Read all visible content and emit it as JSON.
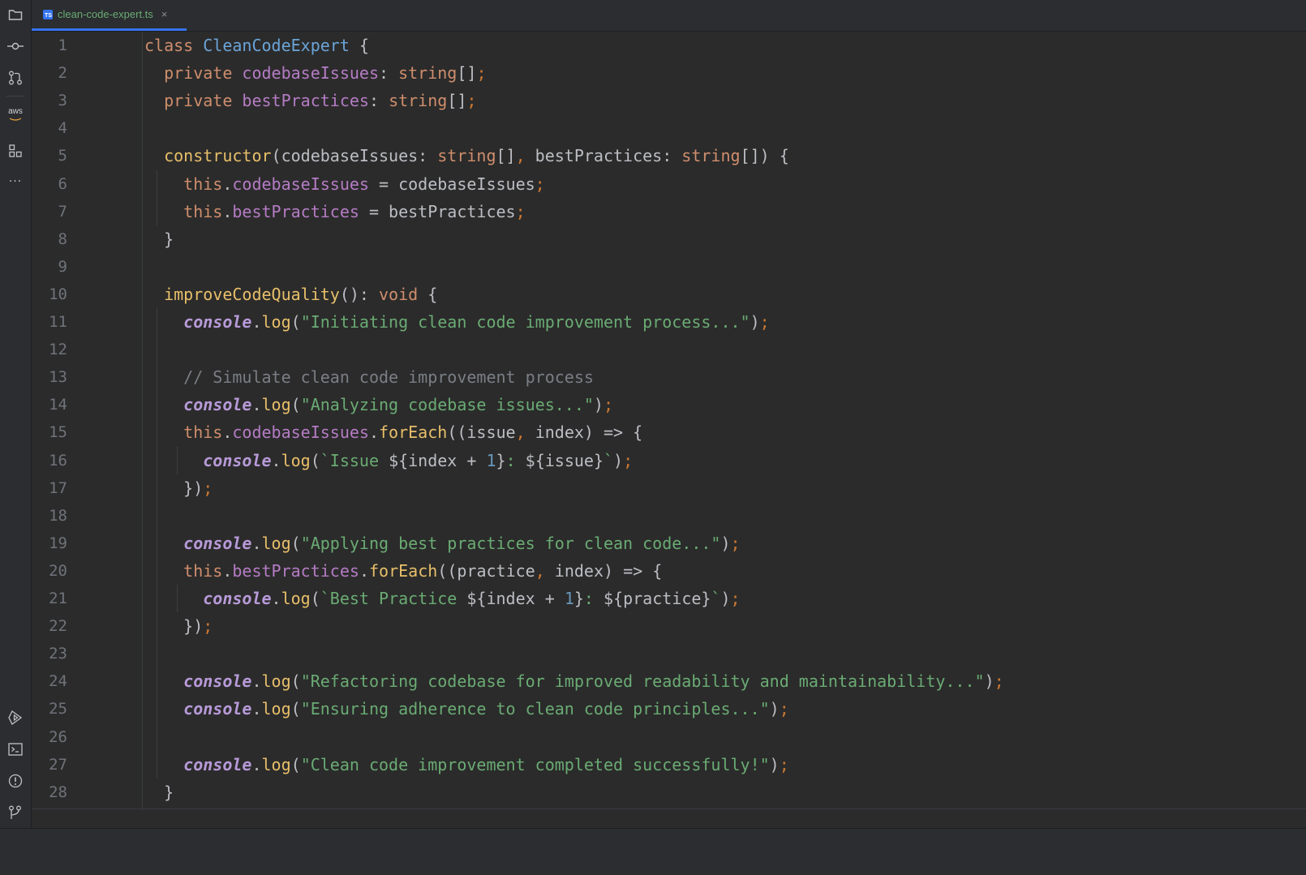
{
  "tab": {
    "filename": "clean-code-expert.ts",
    "badge": "TS",
    "close": "×"
  },
  "sidebar": {
    "aws_label": "aws",
    "more": "···"
  },
  "colors": {
    "keyword": "#cf8e6d",
    "class": "#6ba4d8",
    "property": "#b57cc5",
    "function": "#e8bf6a",
    "string": "#6aab73",
    "number": "#6897bb",
    "comment": "#7a7e85",
    "accent": "#3574f0"
  },
  "line_numbers": [
    "1",
    "2",
    "3",
    "4",
    "5",
    "6",
    "7",
    "8",
    "9",
    "10",
    "11",
    "12",
    "13",
    "14",
    "15",
    "16",
    "17",
    "18",
    "19",
    "20",
    "21",
    "22",
    "23",
    "24",
    "25",
    "26",
    "27",
    "28"
  ],
  "code_lines": [
    [
      [
        "kw",
        "class "
      ],
      [
        "cls",
        "CleanCodeExpert"
      ],
      [
        "plain",
        " {"
      ]
    ],
    [
      [
        "plain",
        "  "
      ],
      [
        "kw",
        "private "
      ],
      [
        "prop",
        "codebaseIssues"
      ],
      [
        "plain",
        ": "
      ],
      [
        "type",
        "string"
      ],
      [
        "plain",
        "[]"
      ],
      [
        "semi",
        ";"
      ]
    ],
    [
      [
        "plain",
        "  "
      ],
      [
        "kw",
        "private "
      ],
      [
        "prop",
        "bestPractices"
      ],
      [
        "plain",
        ": "
      ],
      [
        "type",
        "string"
      ],
      [
        "plain",
        "[]"
      ],
      [
        "semi",
        ";"
      ]
    ],
    [],
    [
      [
        "plain",
        "  "
      ],
      [
        "fn",
        "constructor"
      ],
      [
        "plain",
        "(codebaseIssues: "
      ],
      [
        "type",
        "string"
      ],
      [
        "plain",
        "[]"
      ],
      [
        "semi",
        ","
      ],
      [
        "plain",
        " bestPractices: "
      ],
      [
        "type",
        "string"
      ],
      [
        "plain",
        "[]) {"
      ]
    ],
    [
      [
        "plain",
        "    "
      ],
      [
        "kw",
        "this"
      ],
      [
        "plain",
        "."
      ],
      [
        "prop",
        "codebaseIssues"
      ],
      [
        "plain",
        " = codebaseIssues"
      ],
      [
        "semi",
        ";"
      ]
    ],
    [
      [
        "plain",
        "    "
      ],
      [
        "kw",
        "this"
      ],
      [
        "plain",
        "."
      ],
      [
        "prop",
        "bestPractices"
      ],
      [
        "plain",
        " = bestPractices"
      ],
      [
        "semi",
        ";"
      ]
    ],
    [
      [
        "plain",
        "  }"
      ]
    ],
    [],
    [
      [
        "plain",
        "  "
      ],
      [
        "fn",
        "improveCodeQuality"
      ],
      [
        "plain",
        "(): "
      ],
      [
        "kw",
        "void"
      ],
      [
        "plain",
        " {"
      ]
    ],
    [
      [
        "plain",
        "    "
      ],
      [
        "con",
        "console"
      ],
      [
        "plain",
        "."
      ],
      [
        "fn",
        "log"
      ],
      [
        "plain",
        "("
      ],
      [
        "str",
        "\"Initiating clean code improvement process...\""
      ],
      [
        "plain",
        ")"
      ],
      [
        "semi",
        ";"
      ]
    ],
    [],
    [
      [
        "plain",
        "    "
      ],
      [
        "cm",
        "// Simulate clean code improvement process"
      ]
    ],
    [
      [
        "plain",
        "    "
      ],
      [
        "con",
        "console"
      ],
      [
        "plain",
        "."
      ],
      [
        "fn",
        "log"
      ],
      [
        "plain",
        "("
      ],
      [
        "str",
        "\"Analyzing codebase issues...\""
      ],
      [
        "plain",
        ")"
      ],
      [
        "semi",
        ";"
      ]
    ],
    [
      [
        "plain",
        "    "
      ],
      [
        "kw",
        "this"
      ],
      [
        "plain",
        "."
      ],
      [
        "prop",
        "codebaseIssues"
      ],
      [
        "plain",
        "."
      ],
      [
        "fn",
        "forEach"
      ],
      [
        "plain",
        "((issue"
      ],
      [
        "semi",
        ","
      ],
      [
        "plain",
        " index) => {"
      ]
    ],
    [
      [
        "plain",
        "      "
      ],
      [
        "con",
        "console"
      ],
      [
        "plain",
        "."
      ],
      [
        "fn",
        "log"
      ],
      [
        "plain",
        "("
      ],
      [
        "str",
        "`Issue "
      ],
      [
        "plain",
        "${index + "
      ],
      [
        "num",
        "1"
      ],
      [
        "plain",
        "}"
      ],
      [
        "str",
        ": "
      ],
      [
        "plain",
        "${issue}"
      ],
      [
        "str",
        "`"
      ],
      [
        "plain",
        ")"
      ],
      [
        "semi",
        ";"
      ]
    ],
    [
      [
        "plain",
        "    })"
      ],
      [
        "semi",
        ";"
      ]
    ],
    [],
    [
      [
        "plain",
        "    "
      ],
      [
        "con",
        "console"
      ],
      [
        "plain",
        "."
      ],
      [
        "fn",
        "log"
      ],
      [
        "plain",
        "("
      ],
      [
        "str",
        "\"Applying best practices for clean code...\""
      ],
      [
        "plain",
        ")"
      ],
      [
        "semi",
        ";"
      ]
    ],
    [
      [
        "plain",
        "    "
      ],
      [
        "kw",
        "this"
      ],
      [
        "plain",
        "."
      ],
      [
        "prop",
        "bestPractices"
      ],
      [
        "plain",
        "."
      ],
      [
        "fn",
        "forEach"
      ],
      [
        "plain",
        "((practice"
      ],
      [
        "semi",
        ","
      ],
      [
        "plain",
        " index) => {"
      ]
    ],
    [
      [
        "plain",
        "      "
      ],
      [
        "con",
        "console"
      ],
      [
        "plain",
        "."
      ],
      [
        "fn",
        "log"
      ],
      [
        "plain",
        "("
      ],
      [
        "str",
        "`Best Practice "
      ],
      [
        "plain",
        "${index + "
      ],
      [
        "num",
        "1"
      ],
      [
        "plain",
        "}"
      ],
      [
        "str",
        ": "
      ],
      [
        "plain",
        "${practice}"
      ],
      [
        "str",
        "`"
      ],
      [
        "plain",
        ")"
      ],
      [
        "semi",
        ";"
      ]
    ],
    [
      [
        "plain",
        "    })"
      ],
      [
        "semi",
        ";"
      ]
    ],
    [],
    [
      [
        "plain",
        "    "
      ],
      [
        "con",
        "console"
      ],
      [
        "plain",
        "."
      ],
      [
        "fn",
        "log"
      ],
      [
        "plain",
        "("
      ],
      [
        "str",
        "\"Refactoring codebase for improved readability and maintainability...\""
      ],
      [
        "plain",
        ")"
      ],
      [
        "semi",
        ";"
      ]
    ],
    [
      [
        "plain",
        "    "
      ],
      [
        "con",
        "console"
      ],
      [
        "plain",
        "."
      ],
      [
        "fn",
        "log"
      ],
      [
        "plain",
        "("
      ],
      [
        "str",
        "\"Ensuring adherence to clean code principles...\""
      ],
      [
        "plain",
        ")"
      ],
      [
        "semi",
        ";"
      ]
    ],
    [],
    [
      [
        "plain",
        "    "
      ],
      [
        "con",
        "console"
      ],
      [
        "plain",
        "."
      ],
      [
        "fn",
        "log"
      ],
      [
        "plain",
        "("
      ],
      [
        "str",
        "\"Clean code improvement completed successfully!\""
      ],
      [
        "plain",
        ")"
      ],
      [
        "semi",
        ";"
      ]
    ],
    [
      [
        "plain",
        "  }"
      ]
    ]
  ]
}
